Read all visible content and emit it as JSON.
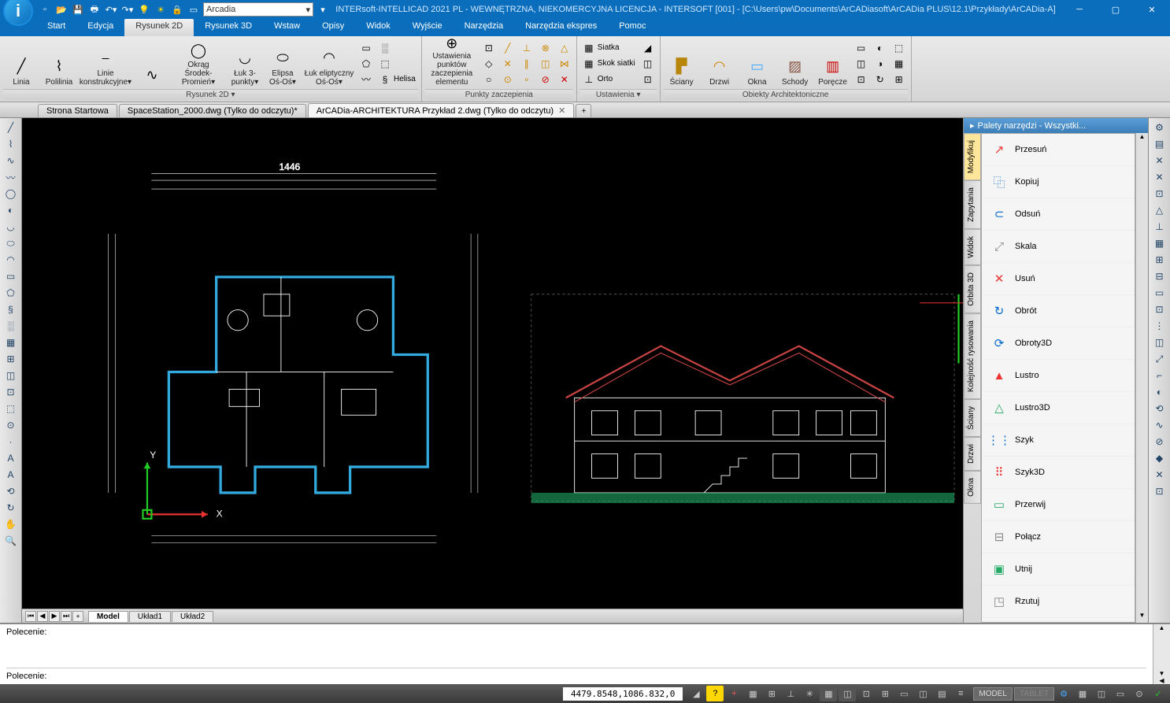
{
  "title": "INTERsoft-INTELLICAD 2021 PL - WEWNĘTRZNA, NIEKOMERCYJNA LICENCJA - INTERSOFT [001] - [C:\\Users\\pw\\Documents\\ArCADiasoft\\ArCADia PLUS\\12.1\\Przykłady\\ArCADia-A]",
  "qat": {
    "layer_selector": "Arcadia"
  },
  "menu": {
    "tabs": [
      "Start",
      "Edycja",
      "Rysunek 2D",
      "Rysunek 3D",
      "Wstaw",
      "Opisy",
      "Widok",
      "Wyjście",
      "Narzędzia",
      "Narzędzia ekspres",
      "Pomoc"
    ],
    "active_index": 2
  },
  "ribbon": {
    "groups": [
      {
        "label": "Rysunek 2D ▾",
        "items": [
          {
            "icon": "╱",
            "label": "Linia"
          },
          {
            "icon": "⌇",
            "label": "Polilinia"
          },
          {
            "icon": "⎯",
            "label": "Linie\nkonstrukcyjne▾",
            "wide": true
          },
          {
            "icon": "∿",
            "label": ""
          },
          {
            "icon": "◯",
            "label": "Okrąg\nŚrodek-Promień▾",
            "wide": true
          },
          {
            "icon": "◡",
            "label": "Łuk\n3-punkty▾"
          },
          {
            "icon": "⬭",
            "label": "Elipsa\nOś-Oś▾"
          },
          {
            "icon": "◠",
            "label": "Łuk eliptyczny\nOś-Oś▾",
            "wide": true
          }
        ],
        "small_cols": [
          [
            {
              "icon": "▭"
            },
            {
              "icon": "⬠"
            },
            {
              "icon": "〰"
            }
          ],
          [
            {
              "icon": "░"
            },
            {
              "icon": "⬚",
              "label": ""
            },
            {
              "icon": "§",
              "label": "Helisa"
            }
          ]
        ]
      },
      {
        "label": "Punkty zaczepienia",
        "items": [
          {
            "icon": "⊕",
            "label": "Ustawienia punktów\nzaczepienia elementu",
            "wide": true
          }
        ],
        "small_cols": [
          [
            {
              "icon": "⊡"
            },
            {
              "icon": "◇"
            },
            {
              "icon": "○"
            }
          ],
          [
            {
              "icon": "╱",
              "color": "#c80"
            },
            {
              "icon": "✕",
              "color": "#c80"
            },
            {
              "icon": "⊙",
              "color": "#c80"
            }
          ],
          [
            {
              "icon": "⊥",
              "color": "#c80"
            },
            {
              "icon": "∥",
              "color": "#c80"
            },
            {
              "icon": "∘",
              "color": "#c80"
            }
          ],
          [
            {
              "icon": "⊗",
              "color": "#c80"
            },
            {
              "icon": "◫",
              "color": "#c80"
            },
            {
              "icon": "⊘",
              "color": "#c00"
            }
          ],
          [
            {
              "icon": "△",
              "color": "#c80"
            },
            {
              "icon": "⋈",
              "color": "#c80"
            },
            {
              "icon": "✕",
              "color": "#c00"
            }
          ]
        ]
      },
      {
        "label": "Ustawienia ▾",
        "small_cols": [
          [
            {
              "icon": "▦",
              "label": "Siatka"
            },
            {
              "icon": "▦",
              "label": "Skok siatki"
            },
            {
              "icon": "⊥",
              "label": "Orto"
            }
          ],
          [
            {
              "icon": "◢"
            },
            {
              "icon": "◫"
            },
            {
              "icon": "⊡"
            }
          ]
        ]
      },
      {
        "label": "Obiekty Architektoniczne",
        "items": [
          {
            "icon": "▛",
            "label": "Ściany",
            "color": "#b8860b"
          },
          {
            "icon": "◠",
            "label": "Drzwi",
            "color": "#c80"
          },
          {
            "icon": "▭",
            "label": "Okna",
            "color": "#4af"
          },
          {
            "icon": "▨",
            "label": "Schody",
            "color": "#854"
          },
          {
            "icon": "▥",
            "label": "Poręcze",
            "color": "#c00"
          }
        ],
        "small_cols": [
          [
            {
              "icon": "▭"
            },
            {
              "icon": "◫"
            },
            {
              "icon": "⊡"
            }
          ],
          [
            {
              "icon": "◐"
            },
            {
              "icon": "◑"
            },
            {
              "icon": "↻"
            }
          ],
          [
            {
              "icon": "⬚"
            },
            {
              "icon": "▦"
            },
            {
              "icon": "⊞"
            }
          ]
        ]
      }
    ]
  },
  "doc_tabs": [
    {
      "label": "Strona Startowa"
    },
    {
      "label": "SpaceStation_2000.dwg (Tylko do odczytu)*"
    },
    {
      "label": "ArCADia-ARCHITEKTURA Przykład 2.dwg (Tylko do odczytu)",
      "active": true,
      "closable": true
    }
  ],
  "layout_tabs": {
    "active": "Model",
    "tabs": [
      "Model",
      "Układ1",
      "Układ2"
    ]
  },
  "palette": {
    "title": "Palety narzędzi - Wszystki...",
    "vtabs": [
      "Modyfikuj",
      "Zapytania",
      "Widok",
      "Orbita 3D",
      "Kolejność rysowania",
      "Ściany",
      "Drzwi",
      "Okna"
    ],
    "active_vtab": 0,
    "items": [
      {
        "icon": "↗",
        "label": "Przesuń",
        "color": "#e33"
      },
      {
        "icon": "⿻",
        "label": "Kopiuj",
        "color": "#06c"
      },
      {
        "icon": "⊂",
        "label": "Odsuń",
        "color": "#06c"
      },
      {
        "icon": "⤢",
        "label": "Skala",
        "color": "#888"
      },
      {
        "icon": "✕",
        "label": "Usuń",
        "color": "#e33"
      },
      {
        "icon": "↻",
        "label": "Obrót",
        "color": "#06c"
      },
      {
        "icon": "⟳",
        "label": "Obroty3D",
        "color": "#06c"
      },
      {
        "icon": "▲",
        "label": "Lustro",
        "color": "#e33"
      },
      {
        "icon": "△",
        "label": "Lustro3D",
        "color": "#2a6"
      },
      {
        "icon": "⋮⋮",
        "label": "Szyk",
        "color": "#06c"
      },
      {
        "icon": "⠿",
        "label": "Szyk3D",
        "color": "#e33"
      },
      {
        "icon": "▭",
        "label": "Przerwij",
        "color": "#2a6"
      },
      {
        "icon": "⊟",
        "label": "Połącz",
        "color": "#888"
      },
      {
        "icon": "▣",
        "label": "Utnij",
        "color": "#2a6"
      },
      {
        "icon": "◳",
        "label": "Rzutuj",
        "color": "#888"
      }
    ]
  },
  "left_tools": [
    "╱",
    "⌇",
    "∿",
    "〰",
    "◯",
    "◐",
    "◡",
    "⬭",
    "◠",
    "▭",
    "⬠",
    "§",
    "░",
    "▦",
    "⊞",
    "◫",
    "⊡",
    "⬚",
    "⊙",
    "·",
    "A",
    "A",
    "⟲",
    "↻",
    "✋",
    "🔍"
  ],
  "right_tools": [
    "⚙",
    "▤",
    "✕",
    "✕",
    "⊡",
    "△",
    "⊥",
    "▦",
    "⊞",
    "⊟",
    "▭",
    "⊡",
    "⋮",
    "◫",
    "⤢",
    "⌐",
    "◐",
    "⟲",
    "∿",
    "⊘",
    "◆",
    "✕",
    "⊡"
  ],
  "command": {
    "prompt": "Polecenie:"
  },
  "status": {
    "coords": "4479.8548,1086.832,0",
    "badges": [
      "MODEL",
      "TABLET"
    ]
  }
}
